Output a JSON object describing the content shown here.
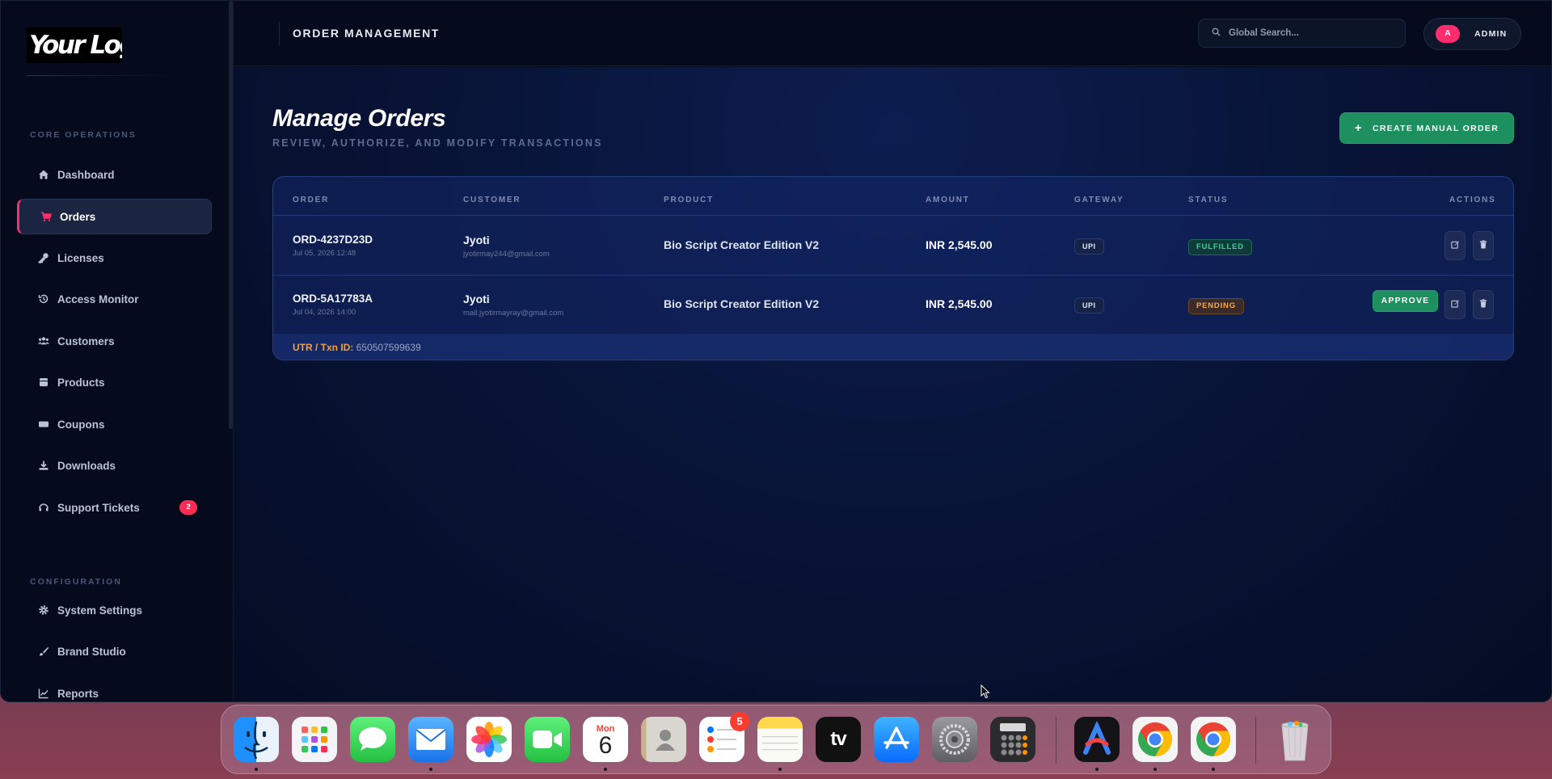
{
  "sidebar": {
    "logo": "Your Logo",
    "section_core": "CORE OPERATIONS",
    "section_config": "CONFIGURATION",
    "items": [
      {
        "label": "Dashboard",
        "icon": "home-icon"
      },
      {
        "label": "Orders",
        "icon": "cart-icon",
        "active": true
      },
      {
        "label": "Licenses",
        "icon": "key-icon"
      },
      {
        "label": "Access Monitor",
        "icon": "history-icon"
      },
      {
        "label": "Customers",
        "icon": "users-icon"
      },
      {
        "label": "Products",
        "icon": "box-icon"
      },
      {
        "label": "Coupons",
        "icon": "ticket-icon"
      },
      {
        "label": "Downloads",
        "icon": "download-icon"
      },
      {
        "label": "Support Tickets",
        "icon": "headset-icon",
        "badge": "2"
      }
    ],
    "config_items": [
      {
        "label": "System Settings",
        "icon": "gear-icon"
      },
      {
        "label": "Brand Studio",
        "icon": "brush-icon"
      },
      {
        "label": "Reports",
        "icon": "chart-icon"
      }
    ]
  },
  "header": {
    "title": "ORDER MANAGEMENT",
    "search_placeholder": "Global Search...",
    "avatar_initial": "A",
    "user_label": "ADMIN"
  },
  "main": {
    "title": "Manage Orders",
    "subtitle": "REVIEW, AUTHORIZE, AND MODIFY TRANSACTIONS",
    "create_button": "CREATE MANUAL ORDER",
    "columns": [
      "ORDER",
      "CUSTOMER",
      "PRODUCT",
      "AMOUNT",
      "GATEWAY",
      "STATUS",
      "ACTIONS"
    ],
    "orders": [
      {
        "id": "ORD-4237D23D",
        "date": "Jul 05, 2026 12:48",
        "customer": "Jyoti",
        "email": "jyotirmay244@gmail.com",
        "product": "Bio Script Creator Edition V2",
        "amount": "INR 2,545.00",
        "gateway": "UPI",
        "status": "FULFILLED"
      },
      {
        "id": "ORD-5A17783A",
        "date": "Jul 04, 2026 14:00",
        "customer": "Jyoti",
        "email": "mail.jyotirmayray@gmail.com",
        "product": "Bio Script Creator Edition V2",
        "amount": "INR 2,545.00",
        "gateway": "UPI",
        "status": "PENDING",
        "approve_label": "APPROVE"
      }
    ],
    "utr_label": "UTR / Txn ID:",
    "utr_value": "650507599639"
  },
  "dock": {
    "calendar_month": "Mon",
    "calendar_day": "6",
    "reminders_badge": "5",
    "tv_label": "tv",
    "apps": [
      "finder-icon",
      "launchpad-icon",
      "messages-icon",
      "mail-icon",
      "photos-icon",
      "facetime-icon",
      "calendar-icon",
      "contacts-icon",
      "reminders-icon",
      "notes-icon",
      "apple-tv-icon",
      "app-store-icon",
      "system-settings-icon",
      "calculator-icon",
      "arc-icon",
      "chrome-icon",
      "chrome-icon",
      "trash-icon"
    ]
  },
  "colors": {
    "accent_pink": "#ff2d6e",
    "success_green": "#1e8f5e",
    "pending_orange": "#f6a94a",
    "background": "#060c1e"
  }
}
